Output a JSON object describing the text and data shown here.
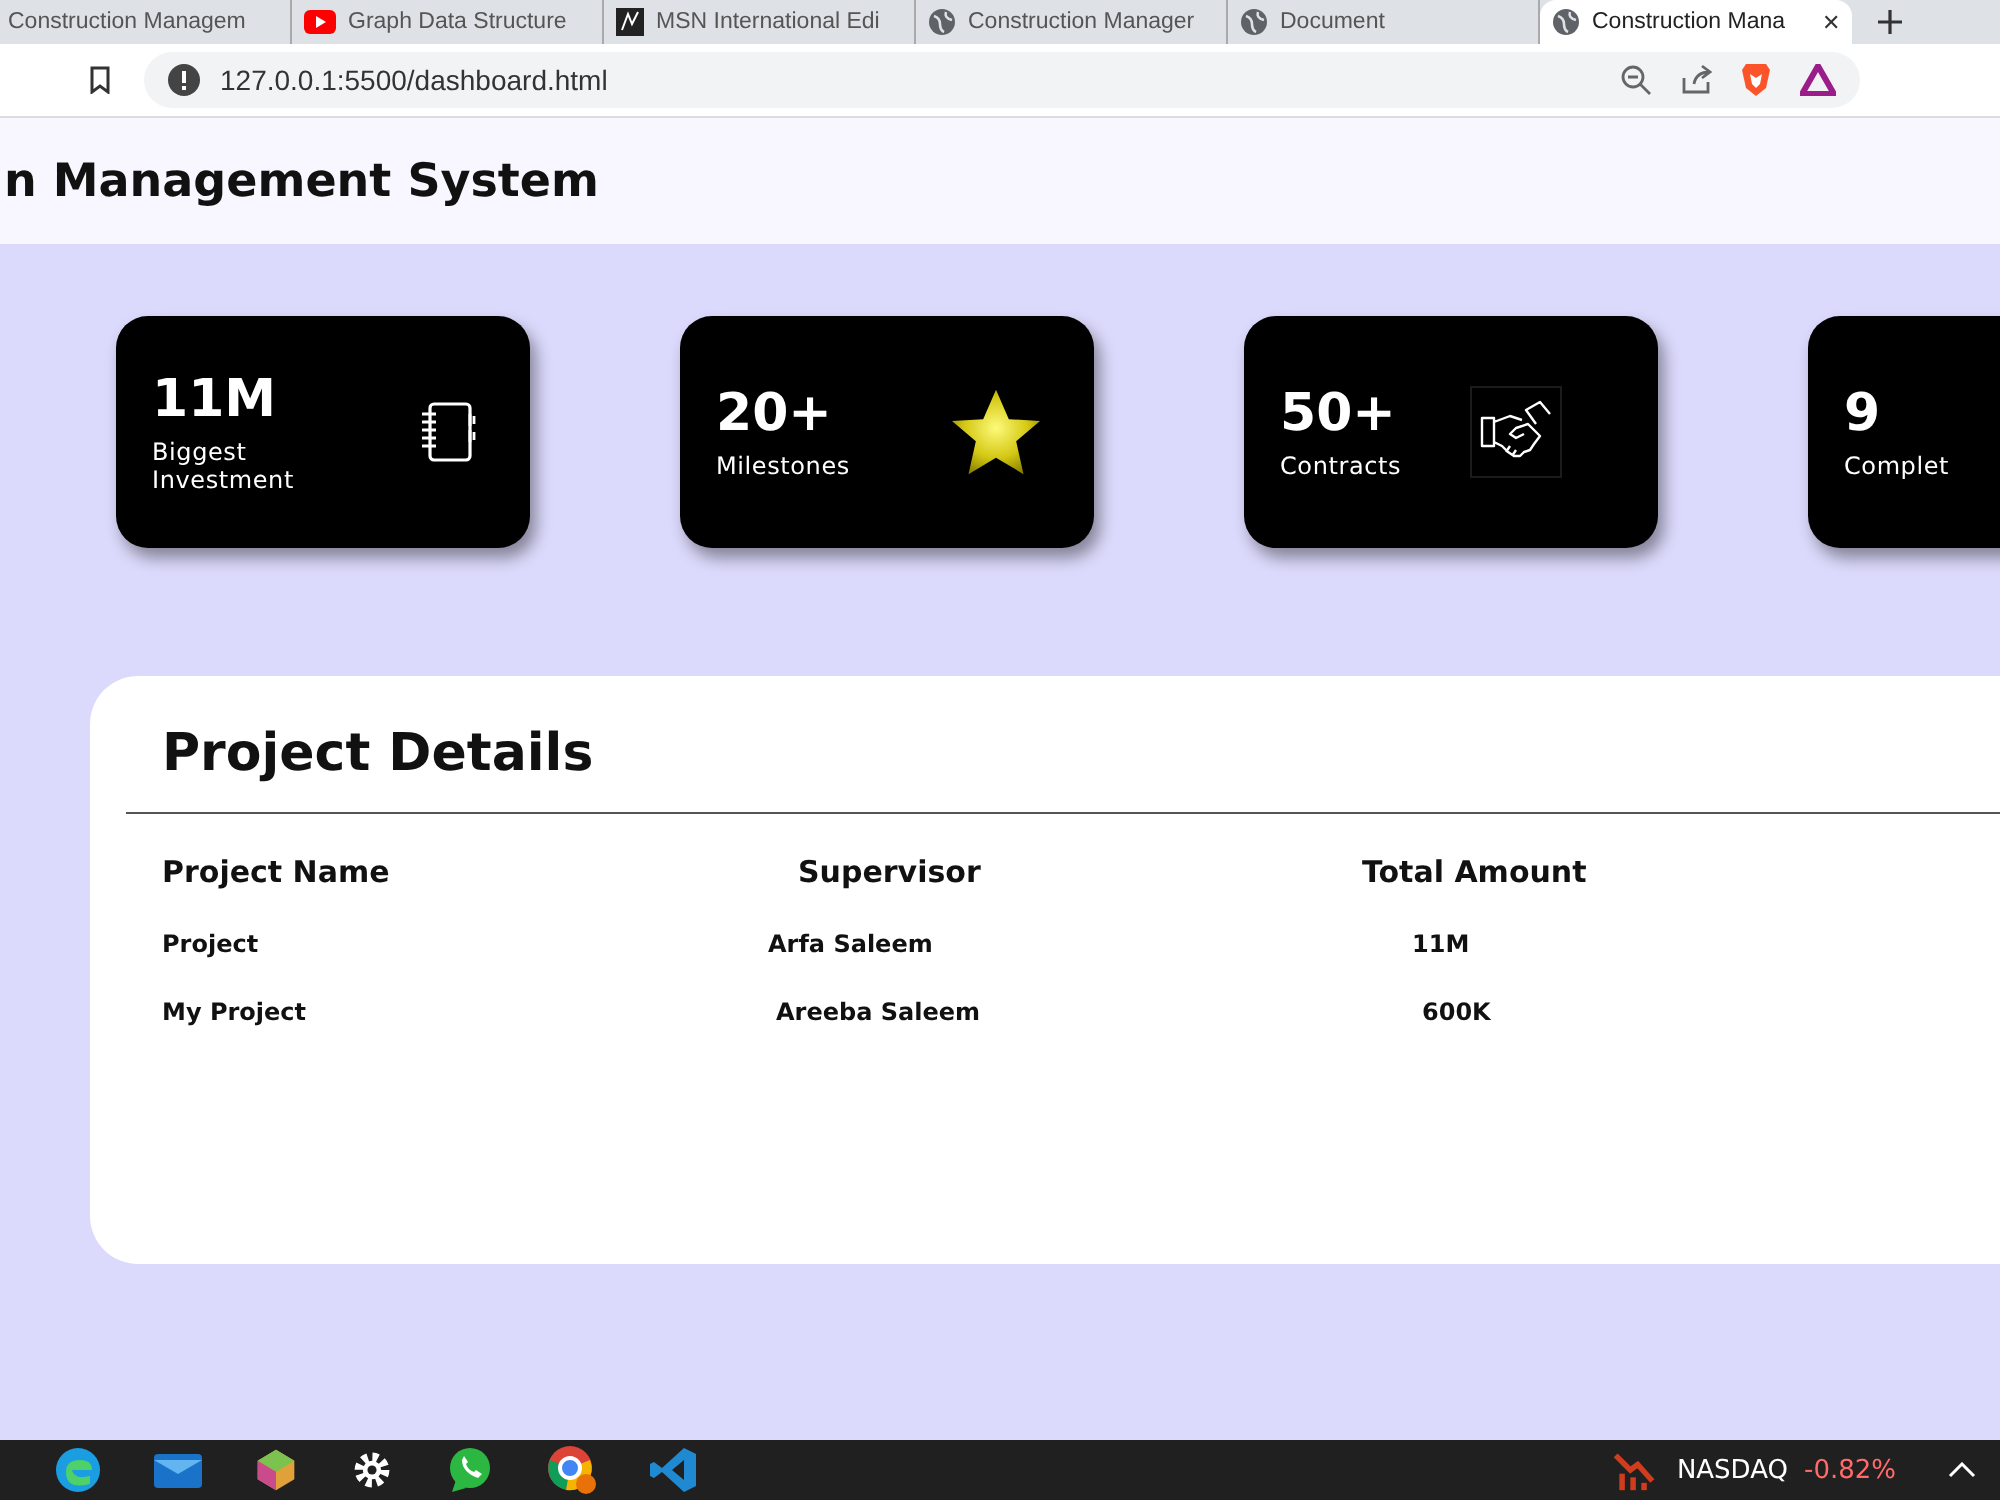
{
  "browser": {
    "tabs": [
      {
        "title": "Construction Managem",
        "selected": false
      },
      {
        "title": "Graph Data Structure",
        "selected": false
      },
      {
        "title": "MSN International Edi",
        "selected": false
      },
      {
        "title": "Construction Manager",
        "selected": false
      },
      {
        "title": "Document",
        "selected": false
      },
      {
        "title": "Construction Mana",
        "selected": true
      }
    ],
    "close_tab": "✕",
    "address": "127.0.0.1:5500/dashboard.html"
  },
  "header": {
    "title": "n Management System"
  },
  "stats": [
    {
      "value": "11M",
      "label": "Biggest Investment",
      "kind": "notebook"
    },
    {
      "value": "20+",
      "label": "Milestones",
      "kind": "star"
    },
    {
      "value": "50+",
      "label": "Contracts",
      "kind": "handshake"
    },
    {
      "value": "9",
      "label": "Complet",
      "kind": "none"
    }
  ],
  "project_details": {
    "title": "Project Details",
    "columns": [
      "Project Name",
      "Supervisor",
      "Total Amount"
    ],
    "rows": [
      [
        "Project",
        "Arfa Saleem",
        "11M"
      ],
      [
        "My Project",
        "Areeba Saleem",
        "600K"
      ]
    ]
  },
  "taskbar": {
    "ticker": "NASDAQ",
    "change": "-0.82%"
  }
}
